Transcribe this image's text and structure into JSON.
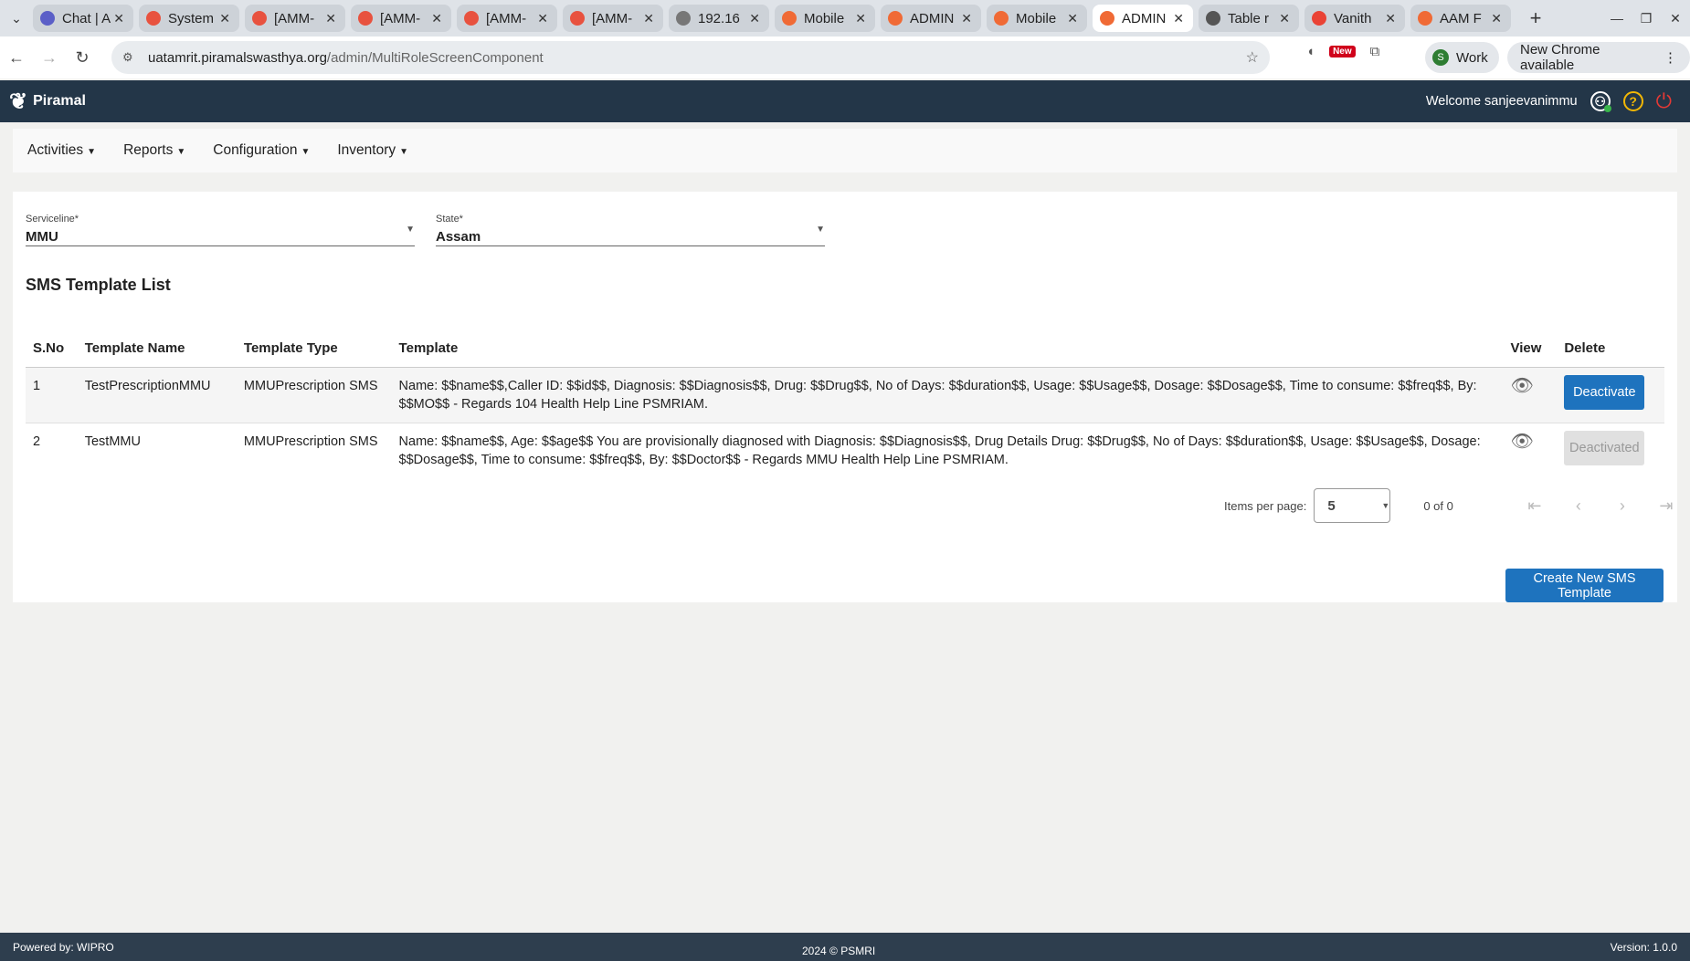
{
  "browser": {
    "tabs": [
      {
        "label": "Chat | A",
        "color": "#5b5fc7",
        "active": false
      },
      {
        "label": "System",
        "color": "#e8523f",
        "active": false
      },
      {
        "label": "[AMM-",
        "color": "#e8523f",
        "active": false
      },
      {
        "label": "[AMM-",
        "color": "#e8523f",
        "active": false
      },
      {
        "label": "[AMM-",
        "color": "#e8523f",
        "active": false
      },
      {
        "label": "[AMM-",
        "color": "#e8523f",
        "active": false
      },
      {
        "label": "192.16",
        "color": "#777777",
        "active": false
      },
      {
        "label": "Mobile",
        "color": "#f06a35",
        "active": false
      },
      {
        "label": "ADMIN",
        "color": "#f06a35",
        "active": false
      },
      {
        "label": "Mobile",
        "color": "#f06a35",
        "active": false
      },
      {
        "label": "ADMIN",
        "color": "#f06a35",
        "active": true
      },
      {
        "label": "Table r",
        "color": "#555555",
        "active": false
      },
      {
        "label": "Vanith",
        "color": "#ea4335",
        "active": false
      },
      {
        "label": "AAM F",
        "color": "#f06a35",
        "active": false
      }
    ],
    "url_host": "uatamrit.piramalswasthya.org",
    "url_path": "/admin/MultiRoleScreenComponent",
    "profile_initial": "S",
    "profile_label": "Work",
    "update_label": "New Chrome available",
    "new_badge": "New"
  },
  "header": {
    "brand": "Piramal",
    "welcome": "Welcome sanjeevanimmu"
  },
  "menu": {
    "items": [
      "Activities",
      "Reports",
      "Configuration",
      "Inventory"
    ]
  },
  "filters": {
    "serviceline_label": "Serviceline*",
    "serviceline_value": "MMU",
    "state_label": "State*",
    "state_value": "Assam"
  },
  "list": {
    "title": "SMS Template List",
    "columns": [
      "S.No",
      "Template Name",
      "Template Type",
      "Template",
      "View",
      "Delete"
    ],
    "rows": [
      {
        "sno": "1",
        "name": "TestPrescriptionMMU",
        "type": "MMUPrescription SMS",
        "template": "Name: $$name$$,Caller ID: $$id$$, Diagnosis: $$Diagnosis$$, Drug: $$Drug$$, No of Days: $$duration$$, Usage: $$Usage$$, Dosage: $$Dosage$$, Time to consume: $$freq$$, By: $$MO$$ - Regards 104 Health Help Line PSMRIAM.",
        "action": "Deactivate"
      },
      {
        "sno": "2",
        "name": "TestMMU",
        "type": "MMUPrescription SMS",
        "template": "Name: $$name$$, Age: $$age$$ You are provisionally diagnosed with Diagnosis: $$Diagnosis$$, Drug Details Drug: $$Drug$$, No of Days: $$duration$$, Usage: $$Usage$$, Dosage: $$Dosage$$, Time to consume: $$freq$$, By: $$Doctor$$ - Regards MMU Health Help Line PSMRIAM.",
        "action": "Deactivated"
      }
    ]
  },
  "paginator": {
    "items_per_page_label": "Items per page:",
    "items_per_page": "5",
    "range": "0 of 0"
  },
  "create_button": "Create New SMS Template",
  "footer": {
    "powered": "Powered by: WIPRO",
    "year": "2024",
    "copyright": "©",
    "org": "PSMRI",
    "version": "Version: 1.0.0"
  },
  "colors": {
    "header_bg": "#233648",
    "primary_button": "#1e73be",
    "footer_bg": "#2e3e4e"
  }
}
